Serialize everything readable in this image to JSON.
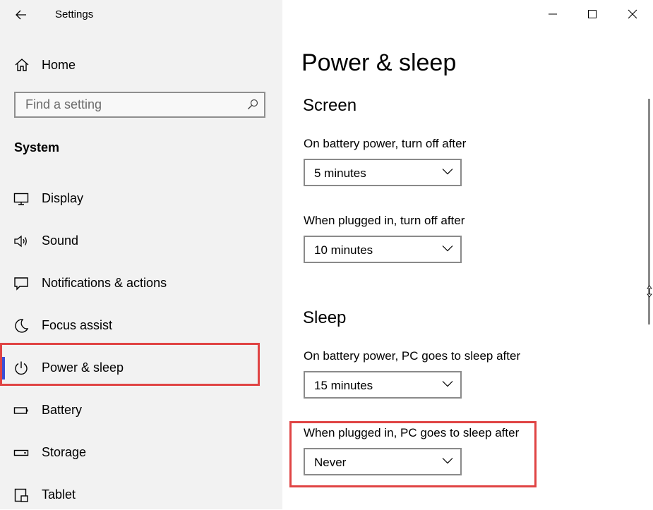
{
  "app": {
    "title": "Settings"
  },
  "sidebar": {
    "home_label": "Home",
    "search_placeholder": "Find a setting",
    "section_label": "System",
    "items": [
      {
        "label": "Display",
        "icon": "display-icon"
      },
      {
        "label": "Sound",
        "icon": "speaker-icon"
      },
      {
        "label": "Notifications & actions",
        "icon": "notification-icon"
      },
      {
        "label": "Focus assist",
        "icon": "moon-icon"
      },
      {
        "label": "Power & sleep",
        "icon": "power-icon",
        "selected": true
      },
      {
        "label": "Battery",
        "icon": "battery-icon"
      },
      {
        "label": "Storage",
        "icon": "storage-icon"
      },
      {
        "label": "Tablet",
        "icon": "tablet-icon"
      }
    ]
  },
  "main": {
    "title": "Power & sleep",
    "screen": {
      "title": "Screen",
      "battery_label": "On battery power, turn off after",
      "battery_value": "5 minutes",
      "plugged_label": "When plugged in, turn off after",
      "plugged_value": "10 minutes"
    },
    "sleep": {
      "title": "Sleep",
      "battery_label": "On battery power, PC goes to sleep after",
      "battery_value": "15 minutes",
      "plugged_label": "When plugged in, PC goes to sleep after",
      "plugged_value": "Never"
    }
  },
  "colors": {
    "highlight": "#e04444",
    "accent": "#3b4fd6",
    "sidebar_bg": "#f2f2f2"
  }
}
